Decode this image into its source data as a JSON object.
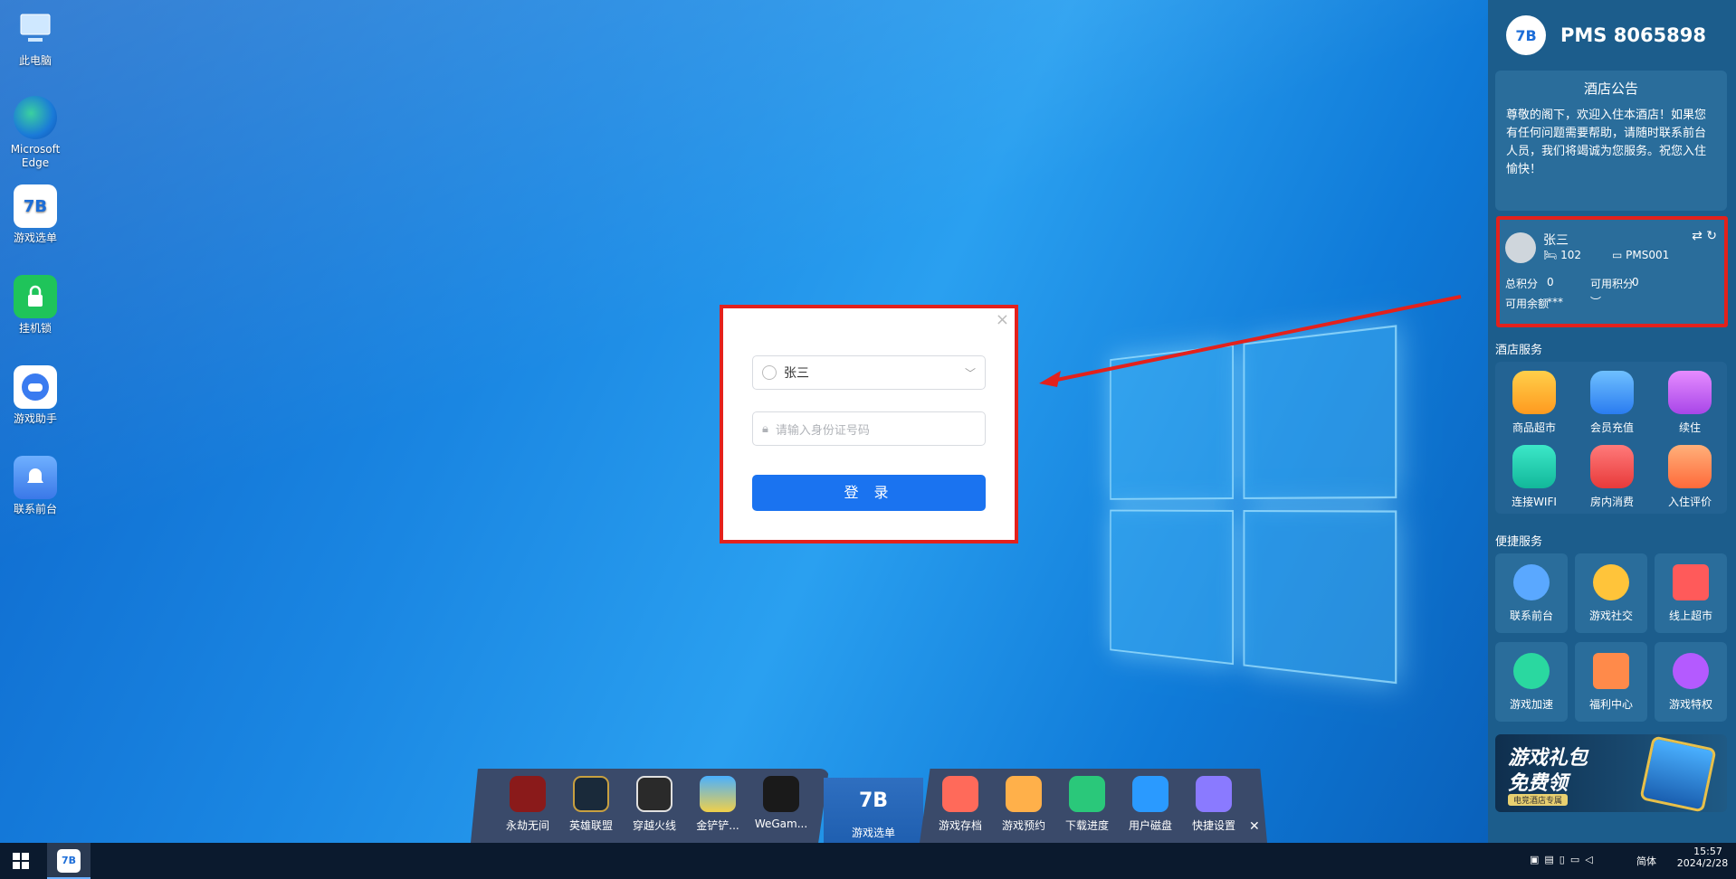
{
  "desktop": {
    "icons": [
      {
        "label": "此电脑"
      },
      {
        "label": "Microsoft Edge"
      },
      {
        "label": "游戏选单"
      },
      {
        "label": "挂机锁"
      },
      {
        "label": "游戏助手"
      },
      {
        "label": "联系前台"
      }
    ]
  },
  "login": {
    "username": "张三",
    "id_placeholder": "请输入身份证号码",
    "submit_label": "登 录"
  },
  "panel": {
    "title": "PMS 8065898",
    "notice_title": "酒店公告",
    "notice_text": "尊敬的阁下，欢迎入住本酒店！如果您有任何问题需要帮助，请随时联系前台人员，我们将竭诚为您服务。祝您入住愉快！",
    "user": {
      "name": "张三",
      "room": "102",
      "machine": "PMS001",
      "total_points_label": "总积分",
      "total_points": "0",
      "available_points_label": "可用积分",
      "available_points": "0",
      "balance_label": "可用余额",
      "balance": "***"
    },
    "hotel_services_title": "酒店服务",
    "hotel_services": [
      "商品超市",
      "会员充值",
      "续住",
      "连接WIFI",
      "房内消费",
      "入住评价"
    ],
    "quick_services_title": "便捷服务",
    "quick_services": [
      "联系前台",
      "游戏社交",
      "线上超市",
      "游戏加速",
      "福利中心",
      "游戏特权"
    ],
    "banner": {
      "line1": "游戏礼包",
      "line2": "免费领",
      "tag": "电竞酒店专属"
    }
  },
  "dock": {
    "games": [
      "永劫无间",
      "英雄联盟",
      "穿越火线",
      "金铲铲...",
      "WeGam..."
    ],
    "center": "游戏选单",
    "tools": [
      "游戏存档",
      "游戏预约",
      "下载进度",
      "用户磁盘",
      "快捷设置"
    ]
  },
  "taskbar": {
    "lang": "简体",
    "time": "15:57",
    "date": "2024/2/28"
  },
  "colors": {
    "accent": "#1a73f0",
    "highlight": "#e3211c",
    "panel": "#1c5d8c"
  }
}
